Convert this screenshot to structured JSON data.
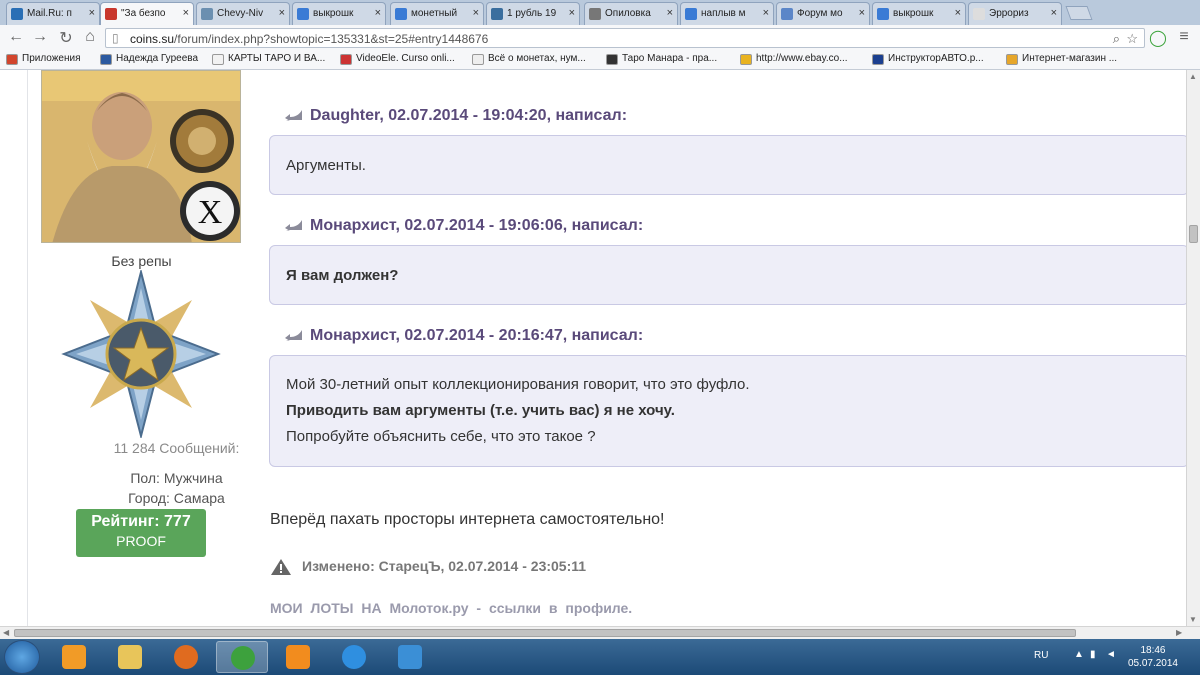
{
  "browser": {
    "tabs": [
      {
        "title": "Mail.Ru: п",
        "favicon_color": "#2a6fb5"
      },
      {
        "title": "\"За безпо",
        "favicon_color": "#c8372d",
        "active": true
      },
      {
        "title": "Chevy-Niv",
        "favicon_color": "#6b8fb0"
      },
      {
        "title": "выкрошк",
        "favicon_color": "#3a7bd5"
      },
      {
        "title": "монетный",
        "favicon_color": "#3a7bd5"
      },
      {
        "title": "1 рубль 19",
        "favicon_color": "#3a6e9e"
      },
      {
        "title": "Опиловка",
        "favicon_color": "#777777"
      },
      {
        "title": "наплыв м",
        "favicon_color": "#3a7bd5"
      },
      {
        "title": "Форум мо",
        "favicon_color": "#5b86c8"
      },
      {
        "title": "выкрошк",
        "favicon_color": "#3a7bd5"
      },
      {
        "title": "Эррориз",
        "favicon_color": "#dddddd"
      }
    ],
    "url_host": "coins.su",
    "url_path": "/forum/index.php?showtopic=135331&st=25#entry1448676",
    "bookmarks": [
      {
        "label": "Приложения",
        "color": "#d2452d"
      },
      {
        "label": "Надежда Гуреева",
        "color": "#2c5aa0"
      },
      {
        "label": "КАРТЫ ТАРО И ВА...",
        "color": "#f2f2f2"
      },
      {
        "label": "VideoEle. Curso onli...",
        "color": "#c33"
      },
      {
        "label": "Всё о монетах, нум...",
        "color": "#eeeeee"
      },
      {
        "label": "Таро Манара - пра...",
        "color": "#333333"
      },
      {
        "label": "http://www.ebay.co...",
        "color": "#e9b320"
      },
      {
        "label": "ИнструкторАВТО.р...",
        "color": "#1b3f8f"
      },
      {
        "label": "Интернет-магазин ...",
        "color": "#e6a62a"
      }
    ]
  },
  "profile": {
    "reputation": "Без репы",
    "posts": "11 284 Сообщений:",
    "gender": "Пол: Мужчина",
    "city": "Город: Самара",
    "rating": "Рейтинг: 777",
    "rating_badge": "PROOF"
  },
  "quotes": [
    {
      "header": "Daughter, 02.07.2014 - 19:04:20, написал:",
      "lines": [
        {
          "text": "Аргументы.",
          "bold": false
        }
      ]
    },
    {
      "header": "Монархист, 02.07.2014 - 19:06:06, написал:",
      "lines": [
        {
          "text": "Я вам должен?",
          "bold": true
        }
      ]
    },
    {
      "header": "Монархист, 02.07.2014 - 20:16:47, написал:",
      "lines": [
        {
          "text": "Мой 30-летний опыт коллекционирования говорит, что это фуфло.",
          "bold": false
        },
        {
          "text": "Приводить вам аргументы (т.е. учить вас) я не хочу.",
          "bold": true
        },
        {
          "text": "Попробуйте объяснить себе, что это такое ?",
          "bold": false
        }
      ]
    }
  ],
  "reply_text": "Вперёд пахать просторы интернета самостоятельно!",
  "edited": "Изменено: СтарецЪ, 02.07.2014 - 23:05:11",
  "signature": "МОИ ЛОТЫ НА Молоток.ру - ссылки в профиле.",
  "taskbar": {
    "apps": [
      {
        "name": "media-player",
        "color": "#f19b27"
      },
      {
        "name": "explorer",
        "color": "#e8c55a"
      },
      {
        "name": "firefox",
        "color": "#e06b1f"
      },
      {
        "name": "chrome",
        "color": "#3da13d",
        "active": true
      },
      {
        "name": "avast",
        "color": "#f28c1e"
      },
      {
        "name": "ie",
        "color": "#2f8fe0"
      },
      {
        "name": "remote",
        "color": "#3b8fd6"
      }
    ],
    "lang": "RU",
    "time": "18:46",
    "date": "05.07.2014"
  }
}
